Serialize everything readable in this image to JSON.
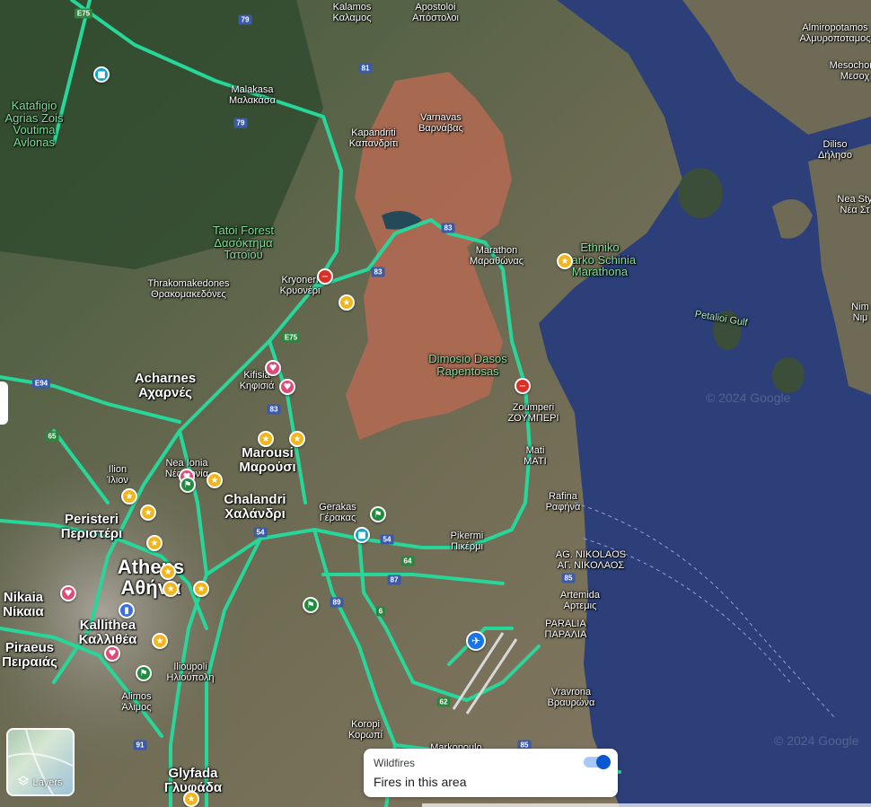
{
  "map": {
    "places": [
      {
        "l1": "Kalamos",
        "l2": "Καλαμος",
        "cls": "small"
      },
      {
        "l1": "Apostoloi",
        "l2": "Απόστολοι",
        "cls": "small"
      },
      {
        "l1": "Almiropotamos",
        "l2": "Αλμυροποταμος",
        "cls": "small"
      },
      {
        "l1": "Mesochoria",
        "l2": "Μεσοχ",
        "cls": "small"
      },
      {
        "l1": "Malakasa",
        "l2": "Μαλακάσα",
        "cls": "small"
      },
      {
        "l1": "Varnavas",
        "l2": "Βαρνάβας",
        "cls": "small"
      },
      {
        "l1": "Kapandriti",
        "l2": "Καπανδρίτι",
        "cls": "small"
      },
      {
        "l1": "Diliso",
        "l2": "Δήλησο",
        "cls": "small"
      },
      {
        "l1": "Nea Sty",
        "l2": "Νέα Στ",
        "cls": "small"
      },
      {
        "l1": "Marathon",
        "l2": "Μαραθώνας",
        "cls": "small"
      },
      {
        "l1": "Thrakomakedones",
        "l2": "Θρακομακεδόνες",
        "cls": "small"
      },
      {
        "l1": "Kryoneri",
        "l2": "Κρυονέρι",
        "cls": "small"
      },
      {
        "l1": "Nim",
        "l2": "Νιμ",
        "cls": "small"
      },
      {
        "l1": "Acharnes",
        "l2": "Αχαρνές",
        "cls": "big"
      },
      {
        "l1": "Kifisia",
        "l2": "Κηφισιά",
        "cls": "small"
      },
      {
        "l1": "Zoumperi",
        "l2": "ΖΟΥΜΠΕΡΙ",
        "cls": "small"
      },
      {
        "l1": "Mati",
        "l2": "ΜΑΤΙ",
        "cls": "small"
      },
      {
        "l1": "Marousi",
        "l2": "Μαρούσι",
        "cls": "big"
      },
      {
        "l1": "Ilion",
        "l2": "Ίλιον",
        "cls": "small"
      },
      {
        "l1": "Nea Ionia",
        "l2": "Νέα Ιωνία",
        "cls": "small"
      },
      {
        "l1": "Chalandri",
        "l2": "Χαλάνδρι",
        "cls": "big"
      },
      {
        "l1": "Rafina",
        "l2": "Ραφήνα",
        "cls": "small"
      },
      {
        "l1": "Gerakas",
        "l2": "Γέρακας",
        "cls": "small"
      },
      {
        "l1": "Peristeri",
        "l2": "Περιστέρι",
        "cls": "big"
      },
      {
        "l1": "Pikermi",
        "l2": "Πικέρμι",
        "cls": "small"
      },
      {
        "l1": "AG. NIKOLAOS",
        "l2": "ΑΓ. ΝΙΚΟΛΑΟΣ",
        "cls": "small"
      },
      {
        "l1": "Athens",
        "l2": "Αθήνα",
        "cls": "xl"
      },
      {
        "l1": "Nikaia",
        "l2": "Νίκαια",
        "cls": "big"
      },
      {
        "l1": "Artemida",
        "l2": "Αρτεμις",
        "cls": "small"
      },
      {
        "l1": "Kallithea",
        "l2": "Καλλιθέα",
        "cls": "big"
      },
      {
        "l1": "PARALIA",
        "l2": "ΠΑΡΑΛΙΑ",
        "cls": "small"
      },
      {
        "l1": "Piraeus",
        "l2": "Πειραιάς",
        "cls": "big"
      },
      {
        "l1": "Ilioupoli",
        "l2": "Ηλιούπολη",
        "cls": "small"
      },
      {
        "l1": "Alimos",
        "l2": "Άλιμος",
        "cls": "small"
      },
      {
        "l1": "Vravrona",
        "l2": "Βραυρώνα",
        "cls": "small"
      },
      {
        "l1": "Koropi",
        "l2": "Κορωπί",
        "cls": "small"
      },
      {
        "l1": "Markopoulo",
        "l2": "",
        "cls": "small"
      },
      {
        "l1": "Glyfada",
        "l2": "Γλυφάδα",
        "cls": "big"
      }
    ],
    "green_labels": [
      {
        "l1": "Katafigio",
        "l2": "Agrias Zois",
        "l3": "Voutima",
        "l4": "Avlonas"
      },
      {
        "l1": "Tatoi Forest",
        "l2": "Δασόκτημα",
        "l3": "Τατοΐου",
        "l4": ""
      },
      {
        "l1": "Dimosio Dasos",
        "l2": "Rapentosas",
        "l3": "",
        "l4": ""
      },
      {
        "l1": "Ethniko",
        "l2": "Parko Schinia",
        "l3": "Marathona",
        "l4": ""
      }
    ],
    "water_label": "Petalioi Gulf",
    "watermark": "© 2024 Google",
    "road_shields": [
      "E75",
      "79",
      "81",
      "79",
      "83",
      "83",
      "E94",
      "65",
      "E75",
      "83",
      "54",
      "54",
      "64",
      "87",
      "89",
      "6",
      "85",
      "62",
      "91",
      "85"
    ]
  },
  "layers": {
    "label": "Layers"
  },
  "wildfires": {
    "title": "Wildfires",
    "subtitle": "Fires in this area",
    "toggle_on": true
  },
  "colors": {
    "road": "#27d79a",
    "fire_area": "#b56a52",
    "sea": "#2c3f78",
    "accent": "#0b57d0"
  }
}
